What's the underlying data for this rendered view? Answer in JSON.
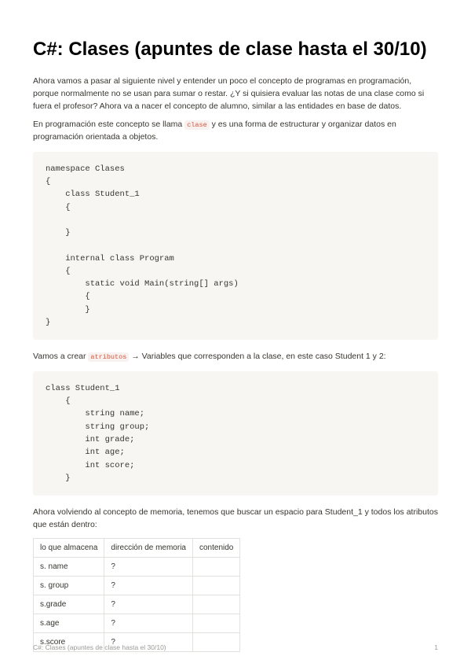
{
  "title": "C#: Clases (apuntes de clase hasta el 30/10)",
  "para1": "Ahora vamos a pasar al siguiente nivel y entender un poco el concepto de programas en programación, porque normalmente no se usan para sumar o restar. ¿Y si quisiera evaluar las notas de una clase como si fuera el profesor? Ahora va a nacer el concepto de alumno, similar a las entidades en base de datos.",
  "para2a": "En programación este concepto se llama ",
  "para2_code": "clase",
  "para2b": " y es una forma de estructurar y organizar datos en programación orientada a objetos.",
  "code1": "namespace Clases\n{\n    class Student_1\n    {\n\n    }\n\n    internal class Program\n    {\n        static void Main(string[] args)\n        {\n        }\n}",
  "para3a": "Vamos a crear ",
  "para3_code": "atributos",
  "para3b": " → Variables que corresponden a la clase, en este caso Student 1 y 2:",
  "code2": "class Student_1\n    {\n        string name;\n        string group;\n        int grade;\n        int age;\n        int score;\n    }",
  "para4": "Ahora volviendo al concepto de memoria, tenemos que buscar un espacio para Student_1 y todos los atributos que están dentro:",
  "table": {
    "headers": [
      "lo que almacena",
      "dirección de memoria",
      "contenido"
    ],
    "rows": [
      [
        "s. name",
        "?",
        ""
      ],
      [
        "s. group",
        "?",
        ""
      ],
      [
        "s.grade",
        "?",
        ""
      ],
      [
        "s.age",
        "?",
        ""
      ],
      [
        "s.score",
        "?",
        ""
      ]
    ]
  },
  "footer_left": "C#: Clases (apuntes de clase hasta el 30/10)",
  "footer_right": "1"
}
